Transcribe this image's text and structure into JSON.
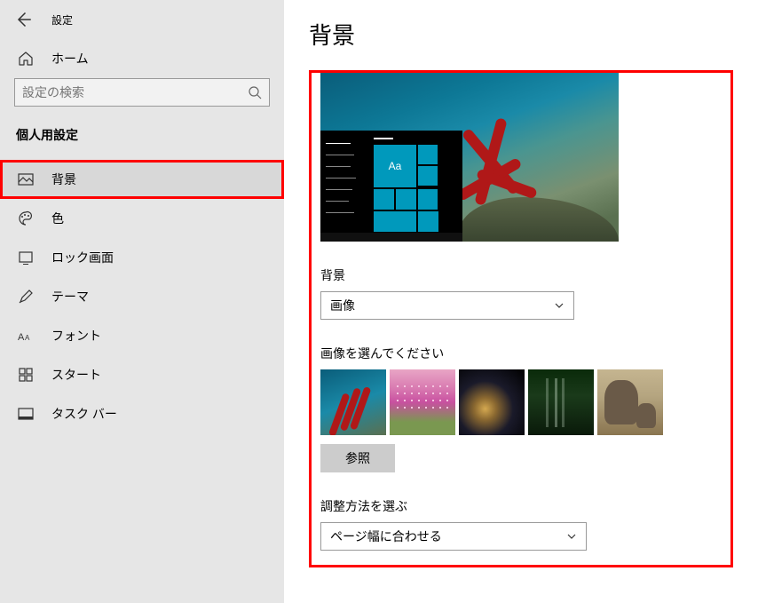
{
  "header": {
    "title": "設定"
  },
  "home": {
    "label": "ホーム"
  },
  "search": {
    "placeholder": "設定の検索"
  },
  "section": {
    "title": "個人用設定"
  },
  "nav": {
    "background": "背景",
    "color": "色",
    "lockscreen": "ロック画面",
    "themes": "テーマ",
    "fonts": "フォント",
    "start": "スタート",
    "taskbar": "タスク バー"
  },
  "page": {
    "title": "背景"
  },
  "preview": {
    "tile_text": "Aa"
  },
  "bg_section": {
    "label": "背景",
    "value": "画像"
  },
  "choose": {
    "label": "画像を選んでください",
    "browse": "参照"
  },
  "fit": {
    "label": "調整方法を選ぶ",
    "value": "ページ幅に合わせる"
  }
}
